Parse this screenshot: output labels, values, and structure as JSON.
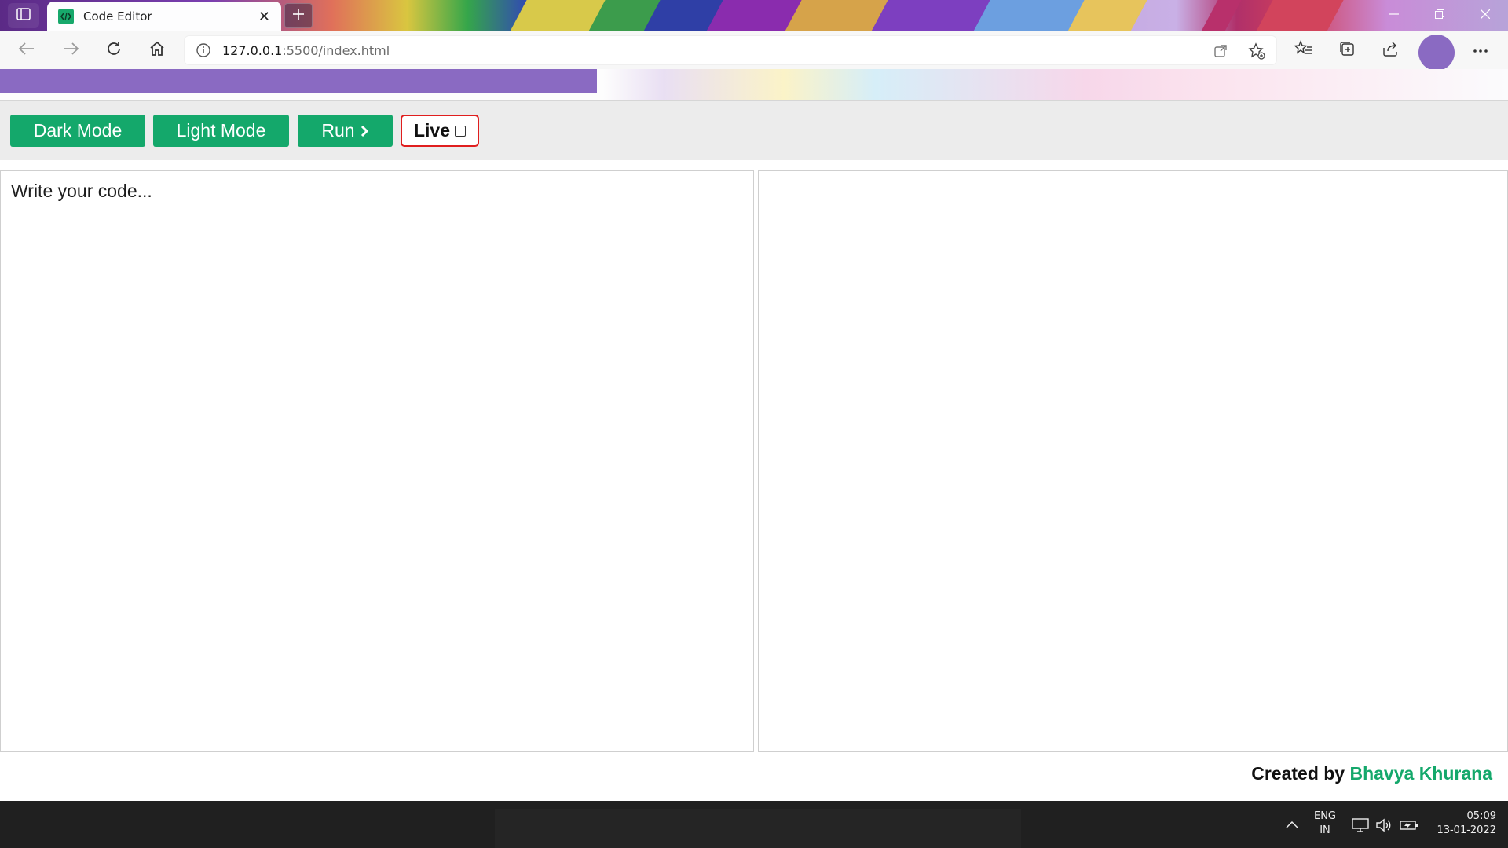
{
  "browser": {
    "tab": {
      "title": "Code Editor"
    },
    "address": {
      "host": "127.0.0.1",
      "path": ":5500/index.html"
    }
  },
  "page": {
    "load_progress_fraction": 0.396
  },
  "toolbar": {
    "dark_mode_label": "Dark Mode",
    "light_mode_label": "Light Mode",
    "run_label": "Run",
    "live_label": "Live",
    "live_checked": false
  },
  "editor": {
    "placeholder": "Write your code..."
  },
  "footer": {
    "prefix": "Created by",
    "author": "Bhavya Khurana"
  },
  "taskbar": {
    "language_line1": "ENG",
    "language_line2": "IN",
    "time": "05:09",
    "date": "13-01-2022"
  },
  "icons": {
    "tab_actions": "tab-actions-icon",
    "favicon": "code-favicon-icon",
    "close": "close-icon",
    "new_tab": "plus-icon",
    "back": "back-arrow-icon",
    "forward": "forward-arrow-icon",
    "refresh": "refresh-icon",
    "home": "home-icon",
    "info": "info-icon",
    "run_chevron": "chevron-right-icon"
  },
  "colors": {
    "accent_green": "#14a86b",
    "live_border": "#e01e1e",
    "progress": "#8a6ac2"
  }
}
